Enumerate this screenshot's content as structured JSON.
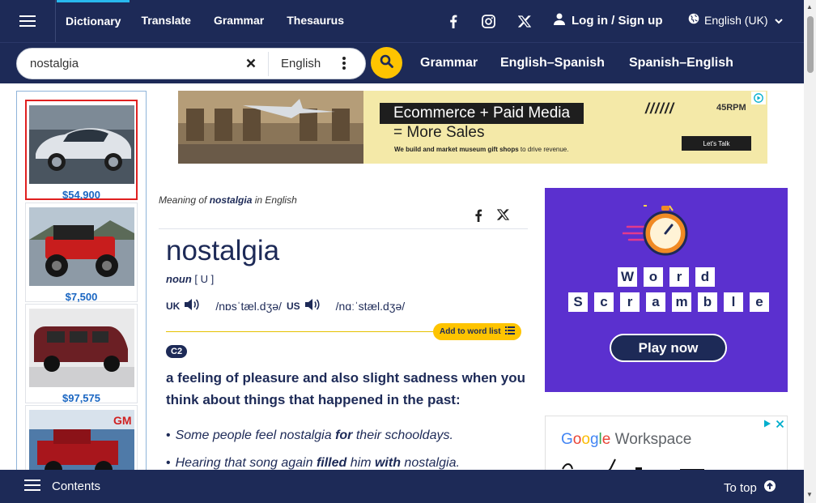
{
  "topnav": {
    "items": [
      "Dictionary",
      "Translate",
      "Grammar",
      "Thesaurus"
    ],
    "social_icons": [
      "facebook-icon",
      "instagram-icon",
      "x-icon"
    ],
    "login_label": "Log in / Sign up",
    "language_label": "English (UK)"
  },
  "search": {
    "value": "nostalgia",
    "dictionary_lang": "English"
  },
  "secondary_nav": {
    "items": [
      "Grammar",
      "English–Spanish",
      "Spanish–English"
    ]
  },
  "left_ad": {
    "cars": [
      {
        "price": "$54,900"
      },
      {
        "price": "$7,500"
      },
      {
        "price": "$97,575"
      },
      {
        "price": ""
      }
    ],
    "banner_text": "GM"
  },
  "top_ad": {
    "headline1": "Ecommerce + Paid Media",
    "headline2": "= More Sales",
    "sub_bold": "We build and market museum gift shops",
    "sub_rest": " to drive revenue.",
    "cta": "Let's Talk",
    "brand": "45RPM",
    "slashes": "//////"
  },
  "entry": {
    "meaning_prefix": "Meaning of ",
    "headword_inline": "nostalgia",
    "meaning_suffix": " in English",
    "headword": "nostalgia",
    "pos": "noun",
    "grammar": " [ U ]",
    "uk_label": "UK",
    "uk_ipa": "/nɒsˈtæl.dʒə/",
    "us_label": "US",
    "us_ipa": "/nɑːˈstæl.dʒə/",
    "add_to_list": "Add to word list",
    "level": "C2",
    "definition": "a feeling of pleasure and also slight sadness when you think about things that happened in the past:",
    "examples": [
      {
        "parts": [
          "Some people feel nostalgia ",
          "for",
          " their schooldays."
        ]
      },
      {
        "parts": [
          "Hearing that song again ",
          "filled",
          " him ",
          "with",
          " nostalgia."
        ]
      }
    ]
  },
  "right_ad": {
    "row1": [
      "W",
      "o",
      "r",
      "d"
    ],
    "row2": [
      "S",
      "c",
      "r",
      "a",
      "m",
      "b",
      "l",
      "e"
    ],
    "play": "Play now"
  },
  "google_ad": {
    "brand": "Google",
    "product": " Workspace"
  },
  "bottombar": {
    "contents": "Contents",
    "to_top": "To top"
  },
  "colors": {
    "navy": "#1d2a57",
    "accent_yellow": "#fec400",
    "ad_purple": "#5b30cf",
    "price_blue": "#1a66c2"
  }
}
